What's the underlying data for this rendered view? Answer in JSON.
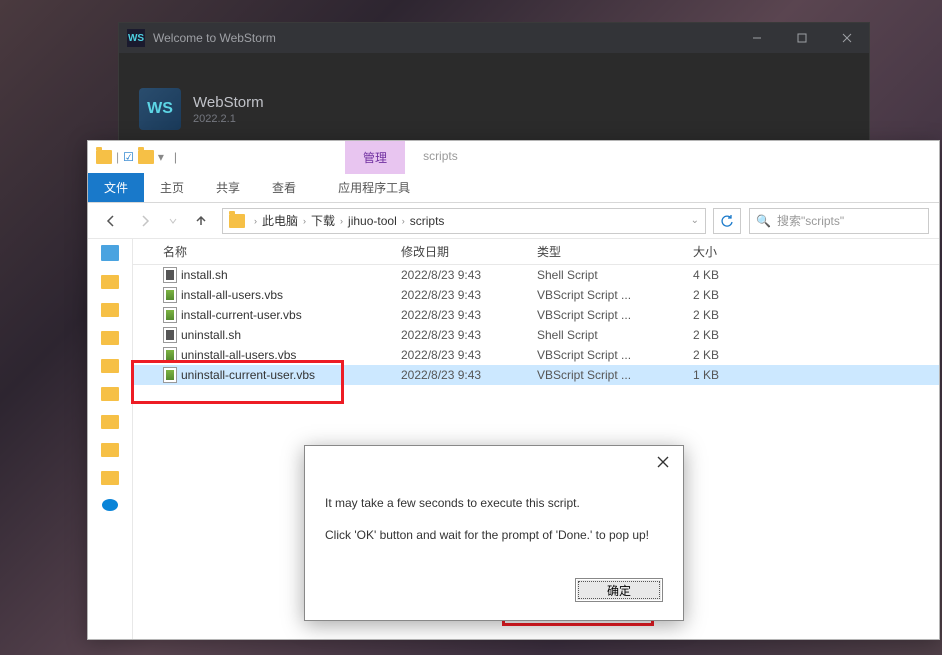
{
  "webstorm": {
    "title": "Welcome to WebStorm",
    "logo_text": "WS",
    "name": "WebStorm",
    "version": "2022.2.1"
  },
  "explorer": {
    "tabs": {
      "manage": "管理",
      "context": "scripts"
    },
    "ribbon": {
      "file": "文件",
      "home": "主页",
      "share": "共享",
      "view": "查看",
      "apptools": "应用程序工具"
    },
    "breadcrumb": [
      "此电脑",
      "下载",
      "jihuo-tool",
      "scripts"
    ],
    "search_placeholder": "搜索\"scripts\"",
    "columns": {
      "name": "名称",
      "date": "修改日期",
      "type": "类型",
      "size": "大小"
    },
    "files": [
      {
        "name": "install.sh",
        "date": "2022/8/23 9:43",
        "type": "Shell Script",
        "size": "4 KB",
        "kind": "sh"
      },
      {
        "name": "install-all-users.vbs",
        "date": "2022/8/23 9:43",
        "type": "VBScript Script ...",
        "size": "2 KB",
        "kind": "vbs"
      },
      {
        "name": "install-current-user.vbs",
        "date": "2022/8/23 9:43",
        "type": "VBScript Script ...",
        "size": "2 KB",
        "kind": "vbs"
      },
      {
        "name": "uninstall.sh",
        "date": "2022/8/23 9:43",
        "type": "Shell Script",
        "size": "2 KB",
        "kind": "sh"
      },
      {
        "name": "uninstall-all-users.vbs",
        "date": "2022/8/23 9:43",
        "type": "VBScript Script ...",
        "size": "2 KB",
        "kind": "vbs"
      },
      {
        "name": "uninstall-current-user.vbs",
        "date": "2022/8/23 9:43",
        "type": "VBScript Script ...",
        "size": "1 KB",
        "kind": "vbs",
        "selected": true
      }
    ]
  },
  "dialog": {
    "line1": "It may take a few seconds to execute this script.",
    "line2": "Click 'OK' button and wait for the prompt of 'Done.' to pop up!",
    "ok": "确定"
  }
}
